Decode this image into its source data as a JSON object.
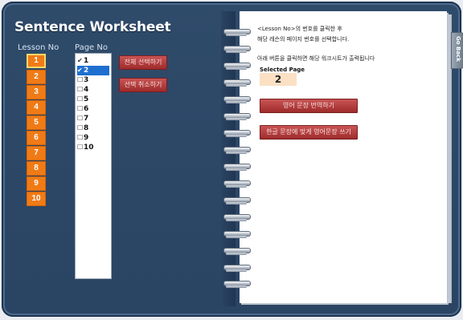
{
  "title": "Sentence Worksheet",
  "left_panel": {
    "lesson_header": "Lesson No",
    "page_header": "Page No",
    "lessons": [
      "1",
      "2",
      "3",
      "4",
      "5",
      "6",
      "7",
      "8",
      "9",
      "10"
    ],
    "pages": [
      {
        "label": "1",
        "checked": true,
        "selected": false
      },
      {
        "label": "2",
        "checked": true,
        "selected": true
      },
      {
        "label": "3",
        "checked": false,
        "selected": false
      },
      {
        "label": "4",
        "checked": false,
        "selected": false
      },
      {
        "label": "5",
        "checked": false,
        "selected": false
      },
      {
        "label": "6",
        "checked": false,
        "selected": false
      },
      {
        "label": "7",
        "checked": false,
        "selected": false
      },
      {
        "label": "8",
        "checked": false,
        "selected": false
      },
      {
        "label": "9",
        "checked": false,
        "selected": false
      },
      {
        "label": "10",
        "checked": false,
        "selected": false
      }
    ],
    "select_all_label": "전체 선택하기",
    "deselect_label": "선택 취소하기"
  },
  "notebook": {
    "info_line1": "<Lesson No>의 번호를 클릭한 후",
    "info_line2": "해당 레슨의 페이지 번호를 선택합니다.",
    "info_line3": "아래 버튼을 클릭하면 해당 워크시트가 출력됩니다",
    "selected_page_label": "Selected Page",
    "selected_page_value": "2",
    "button_translate": "영어 문장 번역하기",
    "button_write": "한글 문장에 맞게 영어문장 쓰기"
  },
  "go_back_label": "Go Back",
  "colors": {
    "background_blue": "#2f4b6a",
    "lesson_orange": "#f07b16",
    "button_red": "#b33b3b",
    "selected_blue": "#1e6fd0",
    "selected_page_bg": "#fbe0c4"
  }
}
